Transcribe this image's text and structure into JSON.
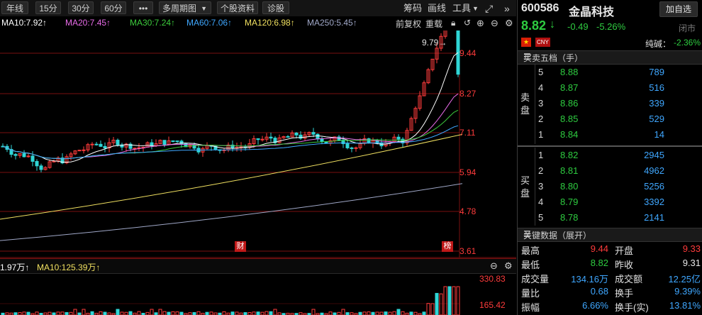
{
  "toolbar": {
    "periods": [
      "年线",
      "15分",
      "30分",
      "60分"
    ],
    "more": "•••",
    "multi_period": "多周期图",
    "stock_info": "个股资料",
    "diagnose": "诊股",
    "chips": "筹码",
    "draw": "画线",
    "tools": "工具"
  },
  "ma_line": [
    {
      "label": "MA10:7.92↑",
      "color": "#ffffff"
    },
    {
      "label": "MA20:7.45↑",
      "color": "#e86be8"
    },
    {
      "label": "MA30:7.24↑",
      "color": "#3ccb3c"
    },
    {
      "label": "MA60:7.06↑",
      "color": "#3fa7ff"
    },
    {
      "label": "MA120:6.98↑",
      "color": "#f0e060"
    },
    {
      "label": "MA250:5.45↑",
      "color": "#a0a8c8"
    }
  ],
  "ma_line_right": {
    "adjust": "前复权",
    "reset": "重载"
  },
  "price_axis": [
    "9.44",
    "8.27",
    "7.11",
    "5.94",
    "4.78",
    "3.61"
  ],
  "max_marker": "9.79→",
  "event_badges": [
    "财",
    "榜"
  ],
  "volume_bar": {
    "vol": "1.97万↑",
    "ma10": "MA10:125.39万↑"
  },
  "volume_axis": [
    "330.83",
    "165.42"
  ],
  "stock": {
    "code": "600586",
    "name": "金晶科技",
    "add_label": "加自选",
    "price": "8.82",
    "arrow": "↓",
    "change": "-0.49",
    "pct": "-5.26%",
    "status": "闭市",
    "cny": "CNY",
    "pure_bid_label": "纯碱：",
    "pure_bid_value": "-2.36%"
  },
  "orderbook": {
    "title": "买卖五档（手）",
    "sell_label": "卖盘",
    "buy_label": "买盘",
    "asks": [
      {
        "level": "5",
        "price": "8.88",
        "vol": "789"
      },
      {
        "level": "4",
        "price": "8.87",
        "vol": "516"
      },
      {
        "level": "3",
        "price": "8.86",
        "vol": "339"
      },
      {
        "level": "2",
        "price": "8.85",
        "vol": "529"
      },
      {
        "level": "1",
        "price": "8.84",
        "vol": "14"
      }
    ],
    "bids": [
      {
        "level": "1",
        "price": "8.82",
        "vol": "2945"
      },
      {
        "level": "2",
        "price": "8.81",
        "vol": "4962"
      },
      {
        "level": "3",
        "price": "8.80",
        "vol": "5256"
      },
      {
        "level": "4",
        "price": "8.79",
        "vol": "3392"
      },
      {
        "level": "5",
        "price": "8.78",
        "vol": "2141"
      }
    ]
  },
  "keydata": {
    "title": "关键数据（展开）",
    "rows": [
      {
        "l1": "最高",
        "v1": "9.44",
        "c1": "red",
        "l2": "开盘",
        "v2": "9.33",
        "c2": "red"
      },
      {
        "l1": "最低",
        "v1": "8.82",
        "c1": "green",
        "l2": "昨收",
        "v2": "9.31",
        "c2": "white"
      },
      {
        "l1": "成交量",
        "v1": "134.16万",
        "c1": "blue",
        "l2": "成交额",
        "v2": "12.25亿",
        "c2": "blue"
      },
      {
        "l1": "量比",
        "v1": "0.68",
        "c1": "blue",
        "l2": "换手",
        "v2": "9.39%",
        "c2": "blue"
      },
      {
        "l1": "振幅",
        "v1": "6.66%",
        "c1": "blue",
        "l2": "换手(实)",
        "v2": "13.81%",
        "c2": "blue"
      }
    ]
  },
  "colors": {
    "up": "#ff3b3b",
    "down": "#2fd6d6",
    "grid": "#7a1010"
  }
}
